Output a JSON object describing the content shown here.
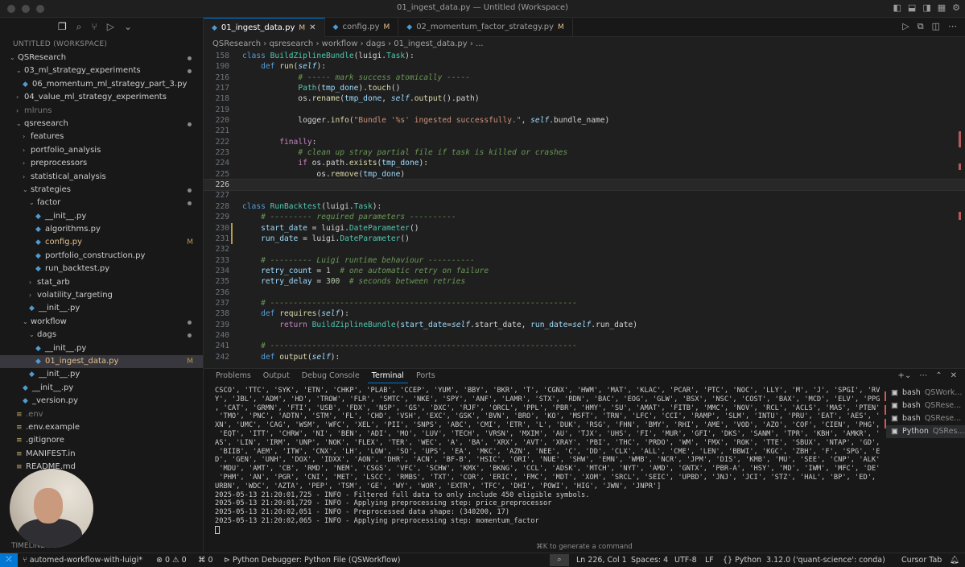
{
  "window": {
    "title": "01_ingest_data.py — Untitled (Workspace)"
  },
  "sidebar": {
    "workspace_label": "UNTITLED (WORKSPACE)",
    "timeline_label": "TIMELINE",
    "tree": [
      {
        "label": "QSResearch",
        "depth": 0,
        "kind": "folder-open",
        "status": "dot"
      },
      {
        "label": "03_ml_strategy_experiments",
        "depth": 1,
        "kind": "folder-open",
        "status": "dot"
      },
      {
        "label": "06_momentum_ml_strategy_part_3.py",
        "depth": 2,
        "kind": "py"
      },
      {
        "label": "04_value_ml_strategy_experiments",
        "depth": 1,
        "kind": "folder"
      },
      {
        "label": "mlruns",
        "depth": 1,
        "kind": "folder",
        "dim": true
      },
      {
        "label": "qsresearch",
        "depth": 1,
        "kind": "folder-open",
        "status": "dot"
      },
      {
        "label": "features",
        "depth": 2,
        "kind": "folder"
      },
      {
        "label": "portfolio_analysis",
        "depth": 2,
        "kind": "folder"
      },
      {
        "label": "preprocessors",
        "depth": 2,
        "kind": "folder"
      },
      {
        "label": "statistical_analysis",
        "depth": 2,
        "kind": "folder"
      },
      {
        "label": "strategies",
        "depth": 2,
        "kind": "folder-open",
        "status": "dot"
      },
      {
        "label": "factor",
        "depth": 3,
        "kind": "folder-open",
        "status": "dot"
      },
      {
        "label": "__init__.py",
        "depth": 4,
        "kind": "py"
      },
      {
        "label": "algorithms.py",
        "depth": 4,
        "kind": "py"
      },
      {
        "label": "config.py",
        "depth": 4,
        "kind": "py",
        "status": "M"
      },
      {
        "label": "portfolio_construction.py",
        "depth": 4,
        "kind": "py"
      },
      {
        "label": "run_backtest.py",
        "depth": 4,
        "kind": "py"
      },
      {
        "label": "stat_arb",
        "depth": 3,
        "kind": "folder"
      },
      {
        "label": "volatility_targeting",
        "depth": 3,
        "kind": "folder"
      },
      {
        "label": "__init__.py",
        "depth": 3,
        "kind": "py"
      },
      {
        "label": "workflow",
        "depth": 2,
        "kind": "folder-open",
        "status": "dot"
      },
      {
        "label": "dags",
        "depth": 3,
        "kind": "folder-open",
        "status": "dot"
      },
      {
        "label": "__init__.py",
        "depth": 4,
        "kind": "py"
      },
      {
        "label": "01_ingest_data.py",
        "depth": 4,
        "kind": "py",
        "status": "M",
        "selected": true
      },
      {
        "label": "__init__.py",
        "depth": 3,
        "kind": "py"
      },
      {
        "label": "__init__.py",
        "depth": 2,
        "kind": "py"
      },
      {
        "label": "_version.py",
        "depth": 2,
        "kind": "py"
      },
      {
        "label": ".env",
        "depth": 1,
        "kind": "txt",
        "dim": true
      },
      {
        "label": ".env.example",
        "depth": 1,
        "kind": "txt"
      },
      {
        "label": ".gitignore",
        "depth": 1,
        "kind": "txt"
      },
      {
        "label": "MANIFEST.in",
        "depth": 1,
        "kind": "txt"
      },
      {
        "label": "README.md",
        "depth": 1,
        "kind": "txt"
      }
    ]
  },
  "tabs": [
    {
      "label": "01_ingest_data.py",
      "status": "M",
      "active": true
    },
    {
      "label": "config.py",
      "status": "M"
    },
    {
      "label": "02_momentum_factor_strategy.py",
      "status": "M"
    }
  ],
  "breadcrumb": [
    "QSResearch",
    "qsresearch",
    "workflow",
    "dags",
    "01_ingest_data.py",
    "..."
  ],
  "code": [
    {
      "n": "158",
      "segs": [
        [
          "k",
          "class "
        ],
        [
          "cls",
          "BuildZiplineBundle"
        ],
        [
          "dflt",
          "(luigi."
        ],
        [
          "cls",
          "Task"
        ],
        [
          "dflt",
          "):"
        ]
      ]
    },
    {
      "n": "190",
      "segs": [
        [
          "dflt",
          "    "
        ],
        [
          "k",
          "def "
        ],
        [
          "f",
          "run"
        ],
        [
          "dflt",
          "("
        ],
        [
          "sf",
          "self"
        ],
        [
          "dflt",
          "):"
        ]
      ]
    },
    {
      "n": "216",
      "segs": [
        [
          "dflt",
          "            "
        ],
        [
          "c",
          "# ----- mark success atomically -----"
        ]
      ]
    },
    {
      "n": "217",
      "segs": [
        [
          "dflt",
          "            "
        ],
        [
          "cls",
          "Path"
        ],
        [
          "dflt",
          "("
        ],
        [
          "p",
          "tmp_done"
        ],
        [
          "dflt",
          ")."
        ],
        [
          "f",
          "touch"
        ],
        [
          "dflt",
          "()"
        ]
      ]
    },
    {
      "n": "218",
      "segs": [
        [
          "dflt",
          "            os."
        ],
        [
          "f",
          "rename"
        ],
        [
          "dflt",
          "("
        ],
        [
          "p",
          "tmp_done"
        ],
        [
          "dflt",
          ", "
        ],
        [
          "sf",
          "self"
        ],
        [
          "dflt",
          "."
        ],
        [
          "f",
          "output"
        ],
        [
          "dflt",
          "().path)"
        ]
      ]
    },
    {
      "n": "219",
      "segs": []
    },
    {
      "n": "220",
      "segs": [
        [
          "dflt",
          "            logger."
        ],
        [
          "f",
          "info"
        ],
        [
          "dflt",
          "("
        ],
        [
          "s",
          "\"Bundle '%s' ingested successfully.\""
        ],
        [
          "dflt",
          ", "
        ],
        [
          "sf",
          "self"
        ],
        [
          "dflt",
          ".bundle_name)"
        ]
      ]
    },
    {
      "n": "221",
      "segs": []
    },
    {
      "n": "222",
      "segs": [
        [
          "dflt",
          "        "
        ],
        [
          "ctl",
          "finally"
        ],
        [
          "dflt",
          ":"
        ]
      ]
    },
    {
      "n": "223",
      "segs": [
        [
          "dflt",
          "            "
        ],
        [
          "c",
          "# clean up stray partial file if task is killed or crashes"
        ]
      ]
    },
    {
      "n": "224",
      "segs": [
        [
          "dflt",
          "            "
        ],
        [
          "ctl",
          "if "
        ],
        [
          "dflt",
          "os.path."
        ],
        [
          "f",
          "exists"
        ],
        [
          "dflt",
          "("
        ],
        [
          "p",
          "tmp_done"
        ],
        [
          "dflt",
          "):"
        ]
      ]
    },
    {
      "n": "225",
      "segs": [
        [
          "dflt",
          "                os."
        ],
        [
          "f",
          "remove"
        ],
        [
          "dflt",
          "("
        ],
        [
          "p",
          "tmp_done"
        ],
        [
          "dflt",
          ")"
        ]
      ]
    },
    {
      "n": "226",
      "segs": [],
      "current": true
    },
    {
      "n": "227",
      "segs": []
    },
    {
      "n": "228",
      "segs": [
        [
          "k",
          "class "
        ],
        [
          "cls",
          "RunBacktest"
        ],
        [
          "dflt",
          "(luigi."
        ],
        [
          "cls",
          "Task"
        ],
        [
          "dflt",
          "):"
        ]
      ]
    },
    {
      "n": "229",
      "segs": [
        [
          "dflt",
          "    "
        ],
        [
          "c",
          "# --------- required parameters ----------"
        ]
      ]
    },
    {
      "n": "230",
      "segs": [
        [
          "dflt",
          "    "
        ],
        [
          "p",
          "start_date"
        ],
        [
          "dflt",
          " = luigi."
        ],
        [
          "cls",
          "DateParameter"
        ],
        [
          "dflt",
          "()"
        ]
      ],
      "gutter": true
    },
    {
      "n": "231",
      "segs": [
        [
          "dflt",
          "    "
        ],
        [
          "p",
          "run_date"
        ],
        [
          "dflt",
          " = luigi."
        ],
        [
          "cls",
          "DateParameter"
        ],
        [
          "dflt",
          "()"
        ]
      ],
      "gutter": true
    },
    {
      "n": "232",
      "segs": []
    },
    {
      "n": "233",
      "segs": [
        [
          "dflt",
          "    "
        ],
        [
          "c",
          "# --------- Luigi runtime behaviour ----------"
        ]
      ]
    },
    {
      "n": "234",
      "segs": [
        [
          "dflt",
          "    "
        ],
        [
          "p",
          "retry_count"
        ],
        [
          "dflt",
          " = "
        ],
        [
          "n",
          "1"
        ],
        [
          "dflt",
          "  "
        ],
        [
          "c",
          "# one automatic retry on failure"
        ]
      ]
    },
    {
      "n": "235",
      "segs": [
        [
          "dflt",
          "    "
        ],
        [
          "p",
          "retry_delay"
        ],
        [
          "dflt",
          " = "
        ],
        [
          "n",
          "300"
        ],
        [
          "dflt",
          "  "
        ],
        [
          "c",
          "# seconds between retries"
        ]
      ]
    },
    {
      "n": "236",
      "segs": []
    },
    {
      "n": "237",
      "segs": [
        [
          "dflt",
          "    "
        ],
        [
          "c",
          "# ------------------------------------------------------------------"
        ]
      ]
    },
    {
      "n": "238",
      "segs": [
        [
          "dflt",
          "    "
        ],
        [
          "k",
          "def "
        ],
        [
          "f",
          "requires"
        ],
        [
          "dflt",
          "("
        ],
        [
          "sf",
          "self"
        ],
        [
          "dflt",
          "):"
        ]
      ]
    },
    {
      "n": "239",
      "segs": [
        [
          "dflt",
          "        "
        ],
        [
          "ctl",
          "return "
        ],
        [
          "cls",
          "BuildZiplineBundle"
        ],
        [
          "dflt",
          "("
        ],
        [
          "p",
          "start_date"
        ],
        [
          "dflt",
          "="
        ],
        [
          "sf",
          "self"
        ],
        [
          "dflt",
          ".start_date, "
        ],
        [
          "p",
          "run_date"
        ],
        [
          "dflt",
          "="
        ],
        [
          "sf",
          "self"
        ],
        [
          "dflt",
          ".run_date)"
        ]
      ]
    },
    {
      "n": "240",
      "segs": []
    },
    {
      "n": "241",
      "segs": [
        [
          "dflt",
          "    "
        ],
        [
          "c",
          "# ------------------------------------------------------------------"
        ]
      ]
    },
    {
      "n": "242",
      "segs": [
        [
          "dflt",
          "    "
        ],
        [
          "k",
          "def "
        ],
        [
          "f",
          "output"
        ],
        [
          "dflt",
          "("
        ],
        [
          "sf",
          "self"
        ],
        [
          "dflt",
          "):"
        ]
      ]
    }
  ],
  "panel": {
    "tabs": [
      "Problems",
      "Output",
      "Debug Console",
      "Terminal",
      "Ports"
    ],
    "active_tab": "Terminal",
    "terminal_lines": [
      "CSCO', 'TTC', 'SYK', 'ETN', 'CHKP', 'PLAB', 'CCEP', 'YUM', 'BBY', 'BKR', 'T', 'CGNX', 'HWM', 'MAT', 'KLAC', 'PCAR', 'PTC', 'NOC', 'LLY', 'M', 'J', 'SPGI', 'RVT",
      "Y', 'JBL', 'ADM', 'HD', 'TROW', 'FLR', 'SMTC', 'NKE', 'SPY', 'ANF', 'LAMR', 'STX', 'RDN', 'BAC', 'EOG', 'GLW', 'BSX', 'NSC', 'COST', 'BAX', 'MCD', 'ELV', 'PPG'",
      ", 'CAT', 'GRMN', 'FTI', 'USB', 'FDX', 'NSP', 'GS', 'DXC', 'RJF', 'ORCL', 'PPL', 'PBR', 'HMY', 'SU', 'AMAT', 'FITB', 'MMC', 'NOV', 'RCL', 'ACLS', 'MAS', 'PTEN',",
      " 'TMO', 'PNC', 'ADTN', 'STM', 'FL', 'CHD', 'VSH', 'EXC', 'GSK', 'BVN', 'BRO', 'KO', 'MSFT', 'TRN', 'LFC', 'CCI', 'RAMP', 'SLM', 'INTU', 'PRU', 'EAT', 'AES', 'T",
      "XN', 'UMC', 'CAG', 'WSM', 'WFC', 'XEL', 'PII', 'SNPS', 'ABC', 'CMI', 'ETR', 'L', 'DUK', 'RSG', 'FHN', 'BMY', 'RHI', 'AME', 'VOD', 'AZO', 'COF', 'CIEN', 'PHG',",
      " 'EQT', 'ITT', 'CHRW', 'NI', 'BEN', 'ADI', 'MO', 'LUV', 'TECH', 'VRSN', 'MXIM', 'AU', 'TJX', 'UHS', 'FI', 'MUR', 'GFI', 'DKS', 'SANM', 'TPR', 'KBH', 'AMKR', 'CT",
      "AS', 'LIN', 'IRM', 'UNP', 'NOK', 'FLEX', 'TER', 'WEC', 'A', 'BA', 'XRX', 'AVT', 'XRAY', 'PBI', 'THC', 'PRDO', 'WM', 'FMX', 'ROK', 'TTE', 'SBUX', 'NTAP', 'GD',",
      " 'BIIB', 'AEM', 'ITW', 'CNX', 'LH', 'LOW', 'SO', 'UPS', 'EA', 'MKC', 'AZN', 'NEE', 'C', 'DD', 'CLX', 'ALL', 'CME', 'LEN', 'BBWI', 'KGC', 'ZBH', 'F', 'SPG', 'EXP",
      "D', 'GEN', 'UNH', 'DOX', 'IDXX', 'AON', 'DHR', 'ACN', 'BF-B', 'HSIC', 'ORI', 'NUE', 'SHW', 'EMN', 'WMB', 'NCR', 'JPM', 'DIS', 'KMB', 'MU', 'SEE', 'CNP', 'ALK',",
      " 'MDU', 'AMT', 'CB', 'RMD', 'NEM', 'CSGS', 'VFC', 'SCHW', 'KMX', 'BKNG', 'CCL', 'ADSK', 'MTCH', 'NYT', 'AMD', 'GNTX', 'PBR-A', 'HSY', 'MD', 'IWM', 'MFC', 'DE',",
      " 'PHM', 'AN', 'PGR', 'CNI', 'MET', 'LSCC', 'RMBS', 'TXT', 'COR', 'ERIC', 'FMC', 'MDT', 'XOM', 'SRCL', 'SEIC', 'UPBD', 'JNJ', 'JCI', 'STZ', 'HAL', 'BP', 'ED', '",
      "URBN', 'WDC', 'AZTA', 'PEP', 'TSM', 'GE', 'WY', 'WOR', 'EXTR', 'TFC', 'DHI', 'POWI', 'HIG', 'JWN', 'JNPR']",
      "2025-05-13 21:20:01,725 - INFO - Filtered full data to only include 450 eligible symbols.",
      "2025-05-13 21:20:01,729 - INFO - Applying preprocessing step: price_preprocessor",
      "2025-05-13 21:20:02,051 - INFO - Preprocessed data shape: (340200, 17)",
      "2025-05-13 21:20:02,065 - INFO - Applying preprocessing step: momentum_factor"
    ],
    "terminals": [
      {
        "name": "bash",
        "sub": "QSWork..."
      },
      {
        "name": "bash",
        "sub": "QSRese..."
      },
      {
        "name": "bash",
        "sub": "QSRese..."
      },
      {
        "name": "Python",
        "sub": "QSRes...",
        "selected": true
      }
    ],
    "hint": "⌘K to generate a command"
  },
  "statusbar": {
    "branch": "automed-workflow-with-luigi*",
    "problems": "⊗ 0 ⚠ 0",
    "ports": "⌘ 0",
    "debug": "Python Debugger: Python File (QSWorkflow)",
    "position": "Ln 226, Col 1",
    "spaces": "Spaces: 4",
    "encoding": "UTF-8",
    "eol": "LF",
    "language": "Python",
    "interpreter": "3.12.0 ('quant-science': conda)",
    "cursor_tab": "Cursor Tab"
  }
}
